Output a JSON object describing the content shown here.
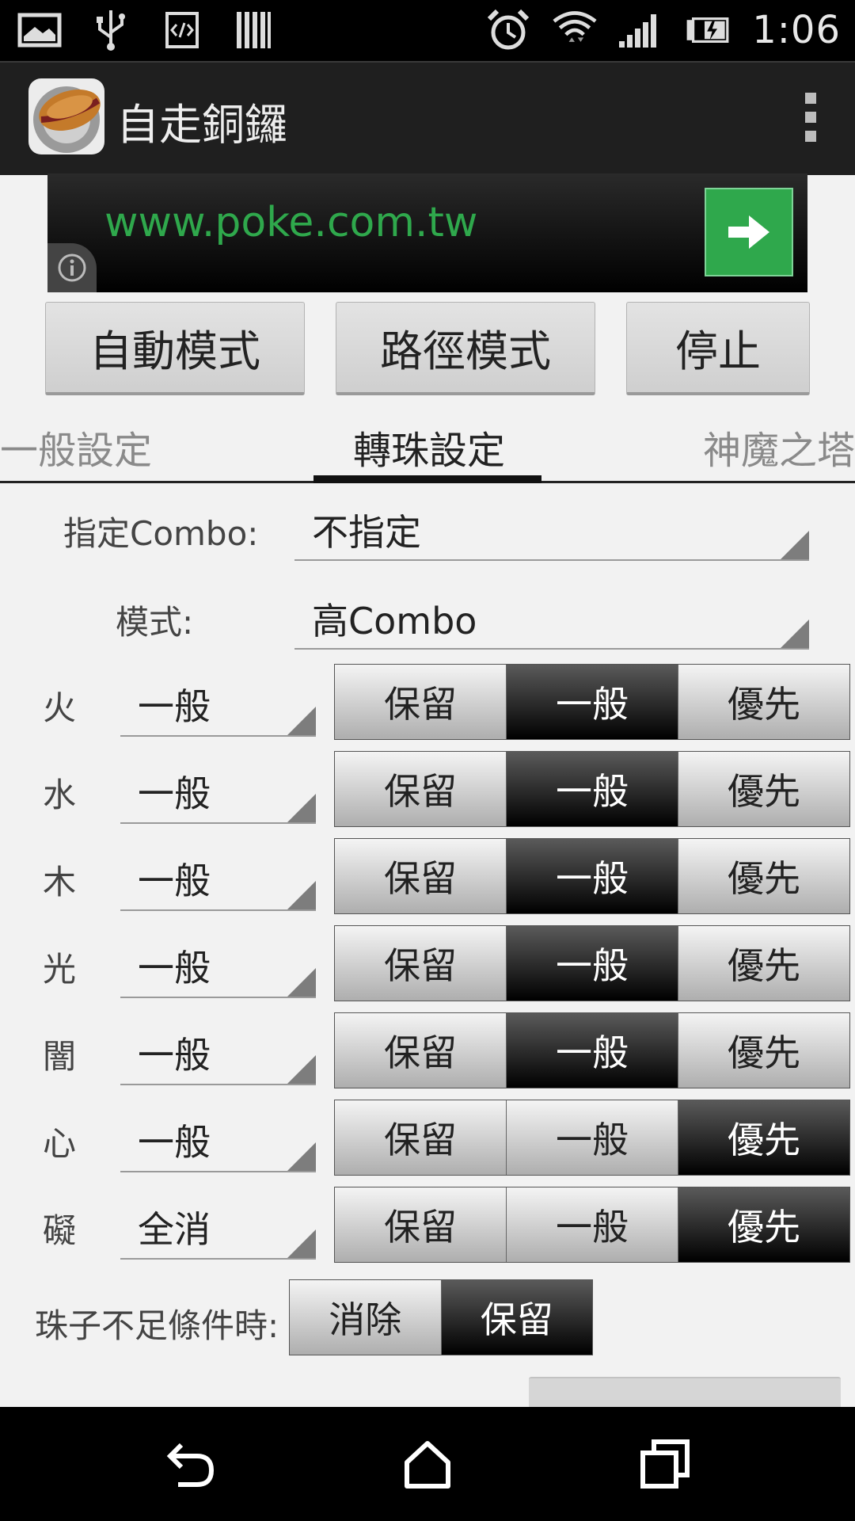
{
  "status_bar": {
    "time": "1:06",
    "left_icons": [
      "gallery-icon",
      "usb-icon",
      "developer-code-icon",
      "barcode-icon"
    ],
    "right_icons": [
      "alarm-icon",
      "wifi-icon",
      "signal-icon",
      "battery-charging-icon"
    ]
  },
  "action_bar": {
    "title": "自走銅鑼",
    "overflow_icon": "overflow-menu-icon"
  },
  "ad": {
    "url": "www.poke.com.tw",
    "button_icon": "arrow-right-icon",
    "info_icon": "info-icon",
    "colors": {
      "url": "#2fa84c",
      "button": "#2fa84c"
    }
  },
  "mode_buttons": {
    "auto": "自動模式",
    "path": "路徑模式",
    "stop": "停止"
  },
  "tabs": {
    "items": [
      {
        "label": "一般設定",
        "selected": false
      },
      {
        "label": "轉珠設定",
        "selected": true
      },
      {
        "label": "神魔之塔",
        "selected": false
      }
    ]
  },
  "combo": {
    "label": "指定Combo:",
    "value": "不指定"
  },
  "mode": {
    "label": "模式:",
    "value": "高Combo"
  },
  "segment_labels": [
    "保留",
    "一般",
    "優先"
  ],
  "attributes": [
    {
      "name": "火",
      "value": "一般",
      "selected": "一般"
    },
    {
      "name": "水",
      "value": "一般",
      "selected": "一般"
    },
    {
      "name": "木",
      "value": "一般",
      "selected": "一般"
    },
    {
      "name": "光",
      "value": "一般",
      "selected": "一般"
    },
    {
      "name": "闇",
      "value": "一般",
      "selected": "一般"
    },
    {
      "name": "心",
      "value": "一般",
      "selected": "優先"
    },
    {
      "name": "礙",
      "value": "全消",
      "selected": "優先"
    }
  ],
  "insufficient": {
    "label": "珠子不足條件時:",
    "options": [
      "消除",
      "保留"
    ],
    "selected": "保留"
  },
  "nav_bar": {
    "icons": [
      "back-icon",
      "home-icon",
      "recent-apps-icon"
    ]
  }
}
